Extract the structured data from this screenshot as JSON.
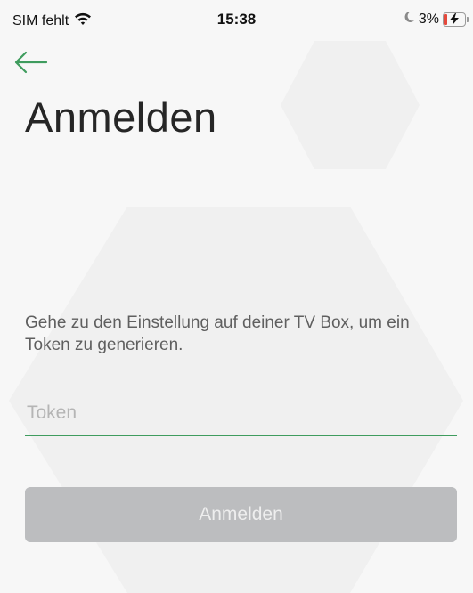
{
  "status_bar": {
    "carrier": "SIM fehlt",
    "time": "15:38",
    "battery": "3%",
    "icons": [
      "wifi-icon",
      "moon-icon",
      "battery-charging-icon"
    ]
  },
  "nav": {
    "back_icon": "arrow-left-icon"
  },
  "page": {
    "title": "Anmelden",
    "instruction": "Gehe zu den Einstellung auf deiner TV Box, um ein Token zu generieren."
  },
  "form": {
    "token_value": "",
    "token_placeholder": "Token",
    "submit_label": "Anmelden"
  },
  "colors": {
    "accent": "#3f9c5e",
    "button_disabled": "#bcbdbf",
    "background": "#f7f7f7",
    "battery_low": "#e5483b"
  }
}
